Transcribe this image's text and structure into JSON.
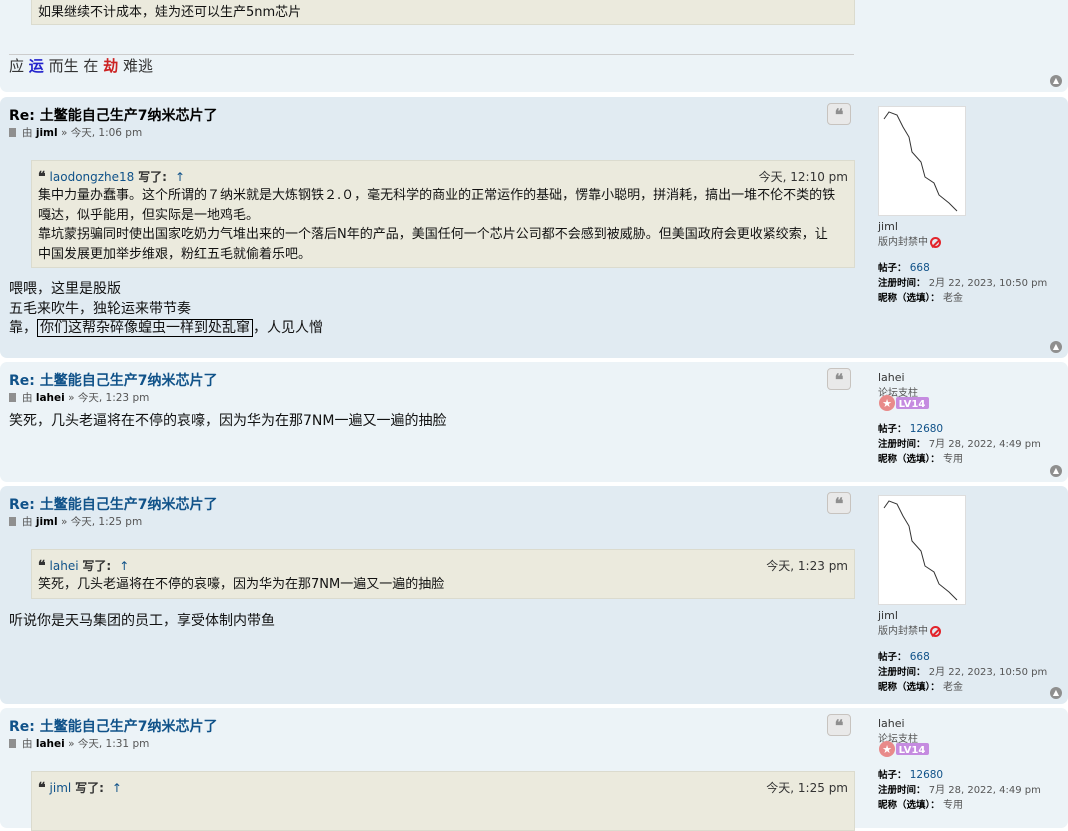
{
  "post0": {
    "quote_tail": "如果继续不计成本，娃为还可以生产5nm芯片",
    "signature": [
      "应",
      "运",
      "而生",
      "在",
      "劫",
      "难逃"
    ],
    "sig_colors": {
      "yun": "#2222cc",
      "jie": "#cc2222"
    }
  },
  "post1": {
    "title": "Re: 土鳖能自己生产7纳米芯片了",
    "by": "由",
    "author": "jiml",
    "sep": "»",
    "time": "今天, 1:06 pm",
    "quote_author": "laodongzhe18",
    "quote_wrote": "写了:",
    "quote_arrow": "↑",
    "quote_time": "今天, 12:10 pm",
    "quote_lines": [
      "集中力量办蠢事。这个所谓的７纳米就是大炼钢铁２.０，毫无科学的商业的正常运作的基础，愣靠小聪明，拼消耗，搞出一堆不伦不类的铁",
      "嘎达，似乎能用，但实际是一地鸡毛。",
      "靠坑蒙拐骗同时使出国家吃奶力气堆出来的一个落后N年的产品，美国任何一个芯片公司都不会感到被威胁。但美国政府会更收紧绞索，让",
      "中国发展更加举步维艰，粉红五毛就偷着乐吧。"
    ],
    "body_lines": [
      "喂喂，这里是股版",
      "五毛来吹牛，独轮运来带节奏"
    ],
    "body_line3_a": "靠，",
    "body_line3_boxed": "你们这帮杂碎像蝗虫一样到处乱窜",
    "body_line3_b": "，人见人憎",
    "profile": {
      "username": "jiml",
      "rank": "版内封禁中",
      "posts_label": "帖子：",
      "posts": "668",
      "joined_label": "注册时间：",
      "joined": "2月 22, 2023, 10:50 pm",
      "nick_label": "昵称（选填）：",
      "nick": "老金"
    }
  },
  "post2": {
    "title": "Re: 土鳖能自己生产7纳米芯片了",
    "by": "由",
    "author": "lahei",
    "sep": "»",
    "time": "今天, 1:23 pm",
    "body": "笑死，几头老逼将在不停的哀嚎，因为华为在那7NM一遍又一遍的抽脸",
    "profile": {
      "username": "lahei",
      "rank": "论坛支柱",
      "badge": "LV14",
      "posts_label": "帖子：",
      "posts": "12680",
      "joined_label": "注册时间：",
      "joined": "7月 28, 2022, 4:49 pm",
      "nick_label": "昵称（选填）：",
      "nick": "专用"
    }
  },
  "post3": {
    "title": "Re: 土鳖能自己生产7纳米芯片了",
    "by": "由",
    "author": "jiml",
    "sep": "»",
    "time": "今天, 1:25 pm",
    "quote_author": "lahei",
    "quote_wrote": "写了:",
    "quote_arrow": "↑",
    "quote_time": "今天, 1:23 pm",
    "quote_body": "笑死，几头老逼将在不停的哀嚎，因为华为在那7NM一遍又一遍的抽脸",
    "body": "听说你是天马集团的员工，享受体制内带鱼",
    "profile": {
      "username": "jiml",
      "rank": "版内封禁中",
      "posts_label": "帖子：",
      "posts": "668",
      "joined_label": "注册时间：",
      "joined": "2月 22, 2023, 10:50 pm",
      "nick_label": "昵称（选填）：",
      "nick": "老金"
    }
  },
  "post4": {
    "title": "Re: 土鳖能自己生产7纳米芯片了",
    "by": "由",
    "author": "lahei",
    "sep": "»",
    "time": "今天, 1:31 pm",
    "quote_author": "jiml",
    "quote_wrote": "写了:",
    "quote_arrow": "↑",
    "quote_time": "今天, 1:25 pm",
    "profile": {
      "username": "lahei",
      "rank": "论坛支柱",
      "badge": "LV14",
      "posts_label": "帖子：",
      "posts": "12680",
      "joined_label": "注册时间：",
      "joined": "7月 28, 2022, 4:49 pm",
      "nick_label": "昵称（选填）：",
      "nick": "专用"
    }
  },
  "icons": {
    "quote": "quote-icon",
    "top": "back-to-top-icon",
    "doc": "post-icon",
    "ban": "ban-icon",
    "lv": "level-badge-icon"
  },
  "colors": {
    "link": "#105289",
    "bg1": "#ecf3f7",
    "bg2": "#e1ebf2",
    "quote_bg": "#ebeadd"
  }
}
